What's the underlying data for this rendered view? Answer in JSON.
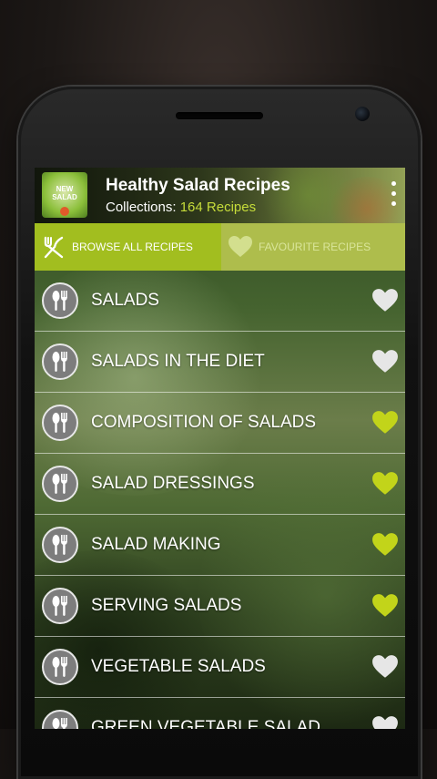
{
  "app": {
    "title": "Healthy Salad Recipes",
    "subtitle_prefix": "Collections: ",
    "subtitle_count": "164 Recipes",
    "icon_text": "NEW SALAD"
  },
  "tabs": {
    "browse_label": "BROWSE ALL RECIPES",
    "favourite_label": "FAVOURITE RECIPES",
    "active": "browse"
  },
  "colors": {
    "accent": "#a2be1f",
    "heart_favourite": "#c2d41a",
    "heart_default": "#e6e6e6"
  },
  "recipes": [
    {
      "label": "SALADS",
      "favourite": false
    },
    {
      "label": "SALADS IN THE DIET",
      "favourite": false
    },
    {
      "label": "COMPOSITION OF SALADS",
      "favourite": true
    },
    {
      "label": "SALAD DRESSINGS",
      "favourite": true
    },
    {
      "label": "SALAD MAKING",
      "favourite": true
    },
    {
      "label": "SERVING SALADS",
      "favourite": true
    },
    {
      "label": "VEGETABLE SALADS",
      "favourite": false
    },
    {
      "label": "GREEN VEGETABLE SALAD.",
      "favourite": false
    }
  ]
}
